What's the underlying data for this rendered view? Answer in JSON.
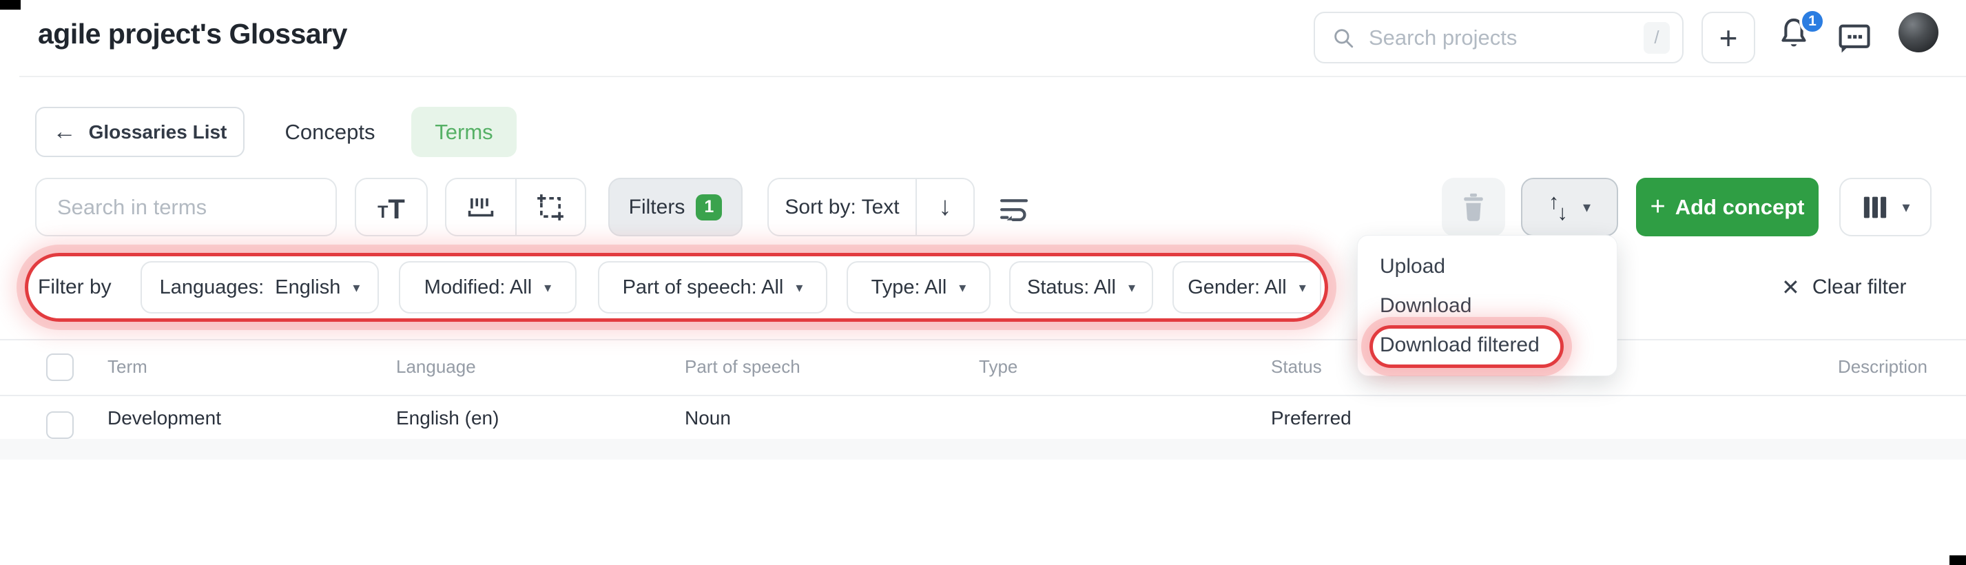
{
  "page": {
    "title": "agile project's Glossary"
  },
  "header": {
    "search_placeholder": "Search projects",
    "search_shortcut": "/",
    "notification_count": "1"
  },
  "nav": {
    "back_label": "Glossaries List",
    "tab_concepts": "Concepts",
    "tab_terms": "Terms"
  },
  "toolbar": {
    "search_placeholder": "Search in terms",
    "filters_label": "Filters",
    "filters_count": "1",
    "sort_label": "Sort by: Text",
    "add_concept_label": "Add concept"
  },
  "filter_bar": {
    "label": "Filter by",
    "chips": [
      {
        "label": "Languages:  English"
      },
      {
        "label": "Modified: All"
      },
      {
        "label": "Part of speech: All"
      },
      {
        "label": "Type: All"
      },
      {
        "label": "Status: All"
      },
      {
        "label": "Gender: All"
      }
    ],
    "clear_label": "Clear filter"
  },
  "menu": {
    "items": [
      "Upload",
      "Download",
      "Download filtered"
    ],
    "highlighted_item": "Download filtered"
  },
  "table": {
    "columns": [
      "Term",
      "Language",
      "Part of speech",
      "Type",
      "Status",
      "Description"
    ],
    "rows": [
      {
        "term": "Development",
        "language": "English (en)",
        "part_of_speech": "Noun",
        "type": "",
        "status": "Preferred",
        "description": ""
      }
    ]
  },
  "icons": {
    "plus": "+",
    "back_arrow": "←",
    "arrow_up": "↑",
    "arrow_down": "↓",
    "caret_down": "▾",
    "close": "✕",
    "t_small": "T",
    "t_large": "T"
  },
  "colors": {
    "accent_green": "#2f9e44",
    "tab_green_bg": "#e7f4e9",
    "tab_green_text": "#55b065",
    "badge_blue": "#2b7de1",
    "annotation_red": "#e23b3f"
  }
}
